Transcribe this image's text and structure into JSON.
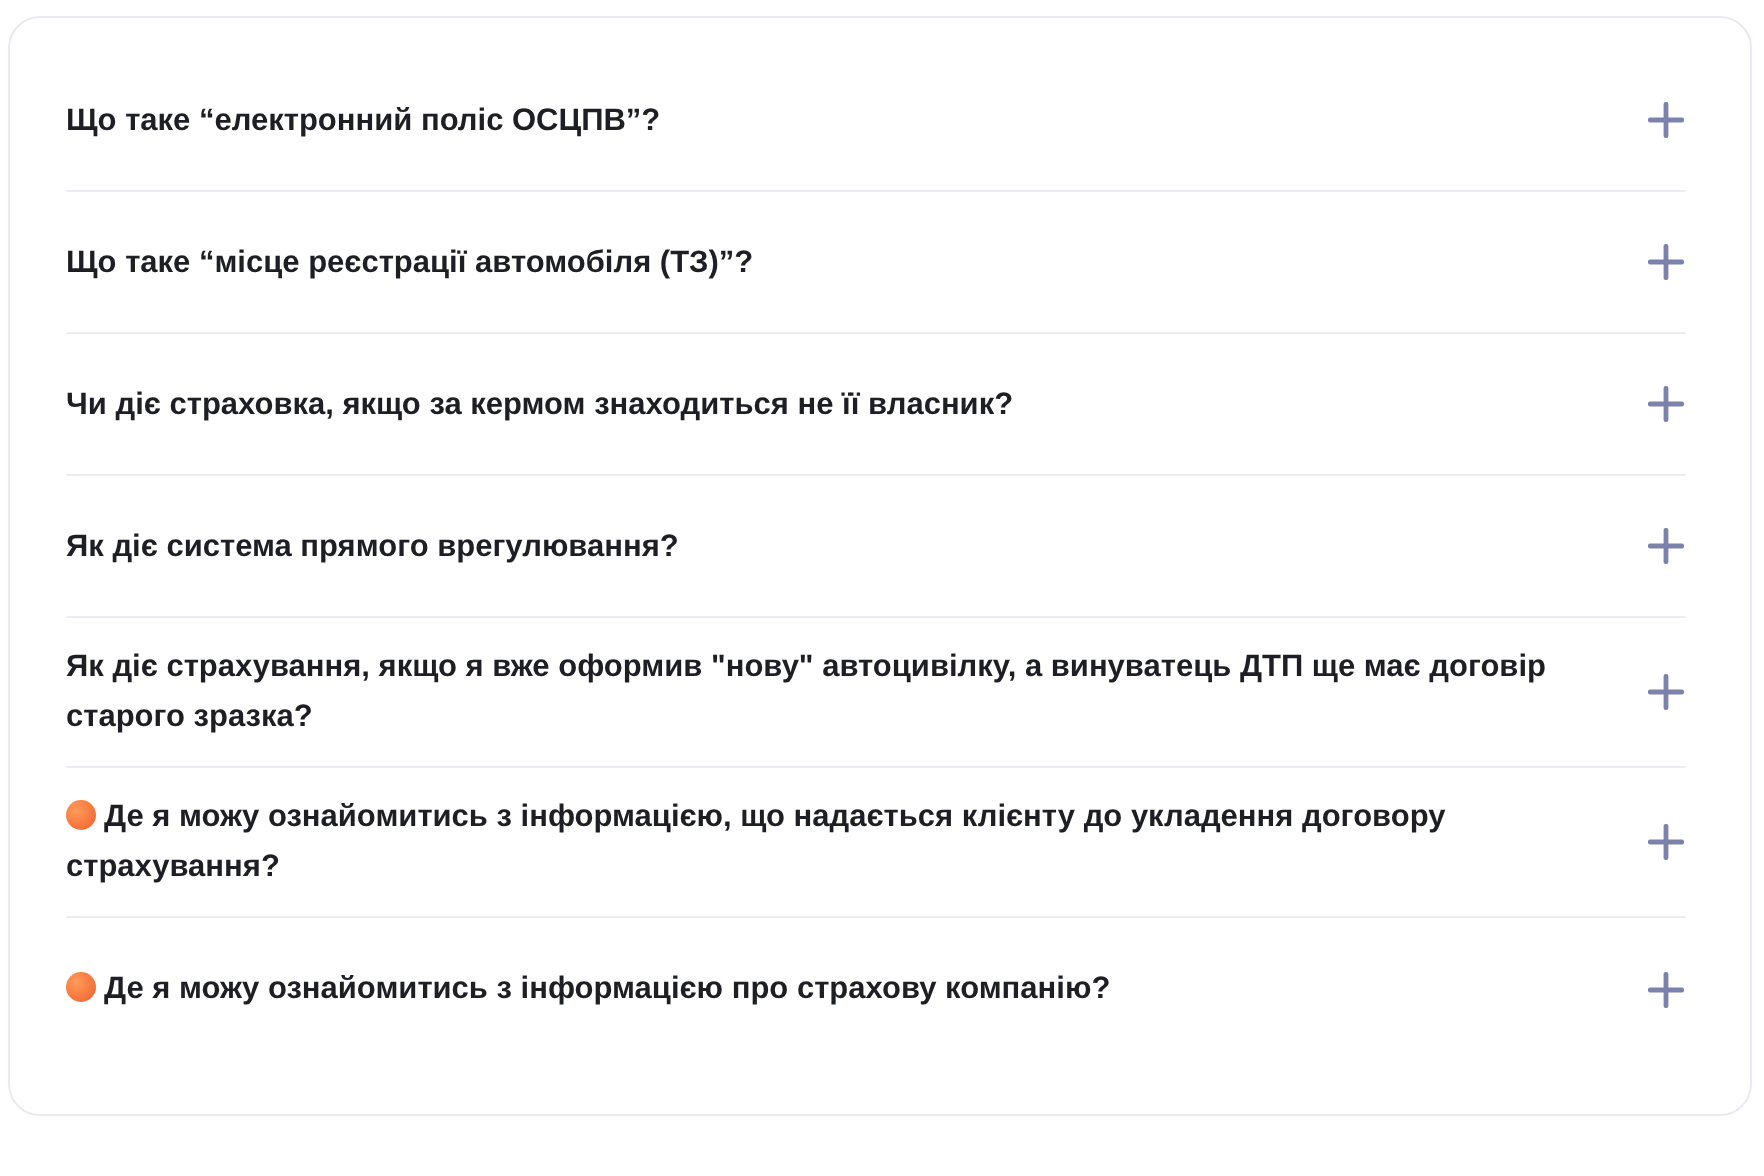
{
  "faq": [
    {
      "question": "Що таке “електронний поліс ОСЦПВ”?",
      "expanded": false,
      "highlighted": false
    },
    {
      "question": "Що таке “місце реєстрації автомобіля (ТЗ)”?",
      "expanded": false,
      "highlighted": false
    },
    {
      "question": "Чи діє страховка, якщо за кермом знаходиться не її власник?",
      "expanded": false,
      "highlighted": false
    },
    {
      "question": "Як діє система прямого врегулювання?",
      "expanded": false,
      "highlighted": false
    },
    {
      "question": "Як діє страхування, якщо я вже оформив \"нову\" автоцивілку, а винуватець ДТП ще має договір старого зразка?",
      "expanded": false,
      "highlighted": false
    },
    {
      "question": "Де я можу ознайомитись з інформацією, що надається клієнту до укладення договору страхування?",
      "expanded": false,
      "highlighted": true
    },
    {
      "question": "Де я можу ознайомитись з інформацією про страхову компанію?",
      "expanded": false,
      "highlighted": true
    }
  ]
}
